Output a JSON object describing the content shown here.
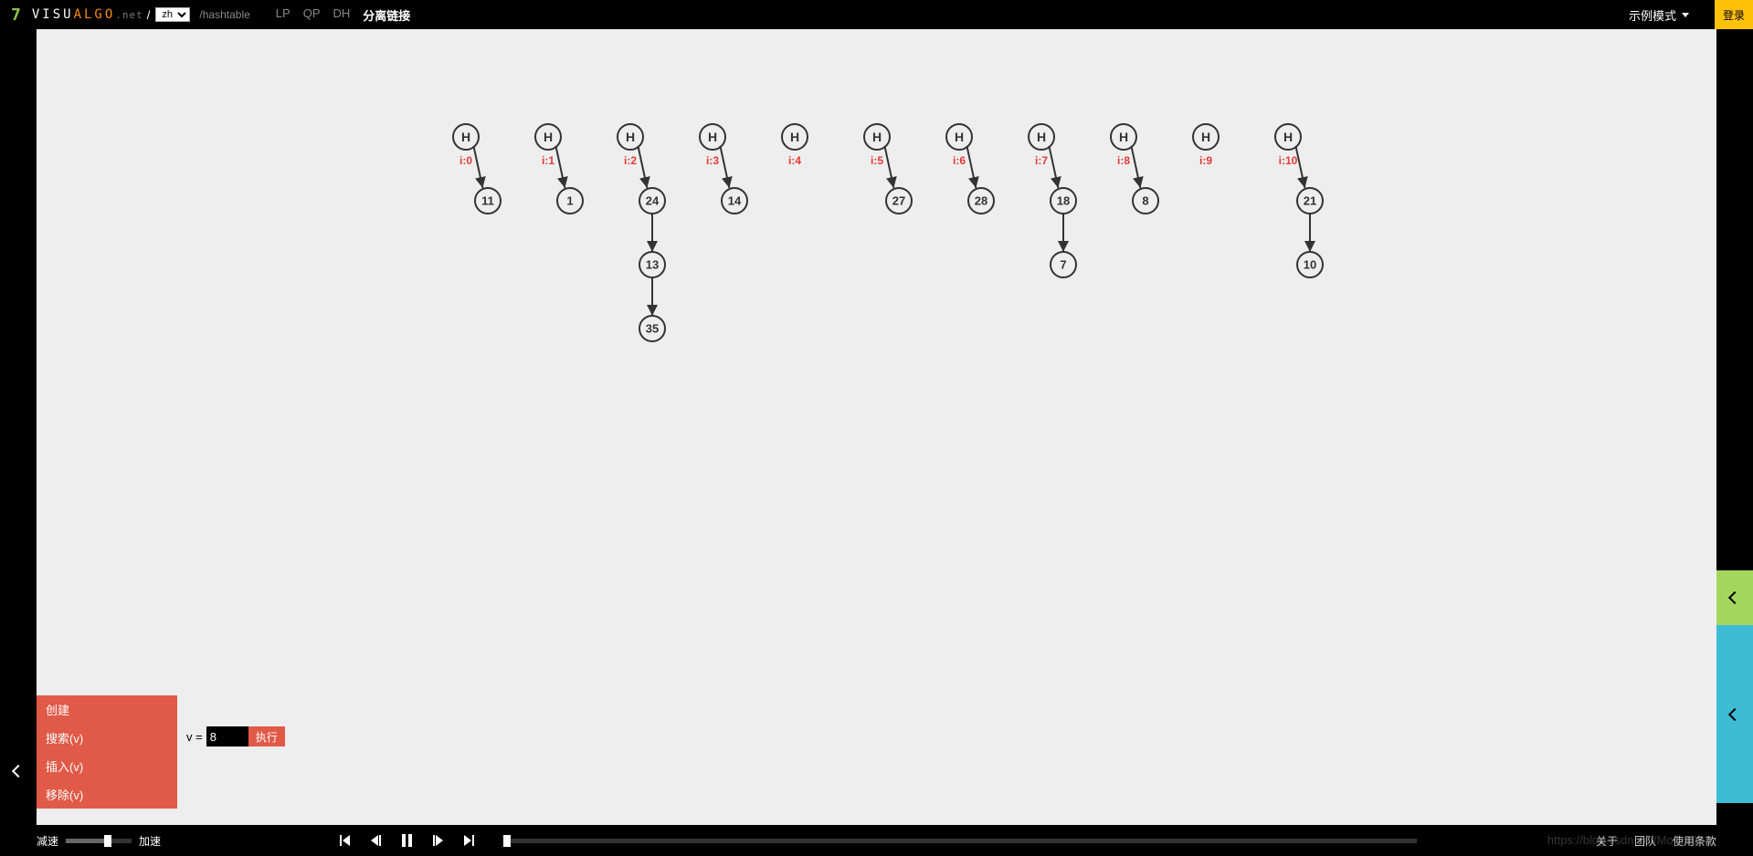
{
  "header": {
    "logo_num": "7",
    "brand_visu": "VISU",
    "brand_algo": "ALGO",
    "brand_net": ".net",
    "lang_value": "zh",
    "path": "/hashtable",
    "tabs": [
      {
        "label": "LP",
        "active": false
      },
      {
        "label": "QP",
        "active": false
      },
      {
        "label": "DH",
        "active": false
      },
      {
        "label": "分离链接",
        "active": true
      }
    ],
    "mode_label": "示例模式",
    "login_label": "登录"
  },
  "buckets": [
    {
      "idx": "i:0",
      "chain": [
        "11"
      ]
    },
    {
      "idx": "i:1",
      "chain": [
        "1"
      ]
    },
    {
      "idx": "i:2",
      "chain": [
        "24",
        "13",
        "35"
      ]
    },
    {
      "idx": "i:3",
      "chain": [
        "14"
      ]
    },
    {
      "idx": "i:4",
      "chain": []
    },
    {
      "idx": "i:5",
      "chain": [
        "27"
      ]
    },
    {
      "idx": "i:6",
      "chain": [
        "28"
      ]
    },
    {
      "idx": "i:7",
      "chain": [
        "18",
        "7"
      ]
    },
    {
      "idx": "i:8",
      "chain": [
        "8"
      ]
    },
    {
      "idx": "i:9",
      "chain": []
    },
    {
      "idx": "i:10",
      "chain": [
        "21",
        "10"
      ]
    }
  ],
  "head_label": "H",
  "action_menu": {
    "create": "创建",
    "search": "搜索(v)",
    "insert": "插入(v)",
    "remove": "移除(v)"
  },
  "input": {
    "v_label": "v =",
    "v_value": "8",
    "exec_label": "执行"
  },
  "bottom": {
    "slow_label": "减速",
    "fast_label": "加速"
  },
  "footer": {
    "about": "关于",
    "team": "团队",
    "terms": "使用条款"
  },
  "watermark": "https://blog.csdn.net/Molly1023"
}
